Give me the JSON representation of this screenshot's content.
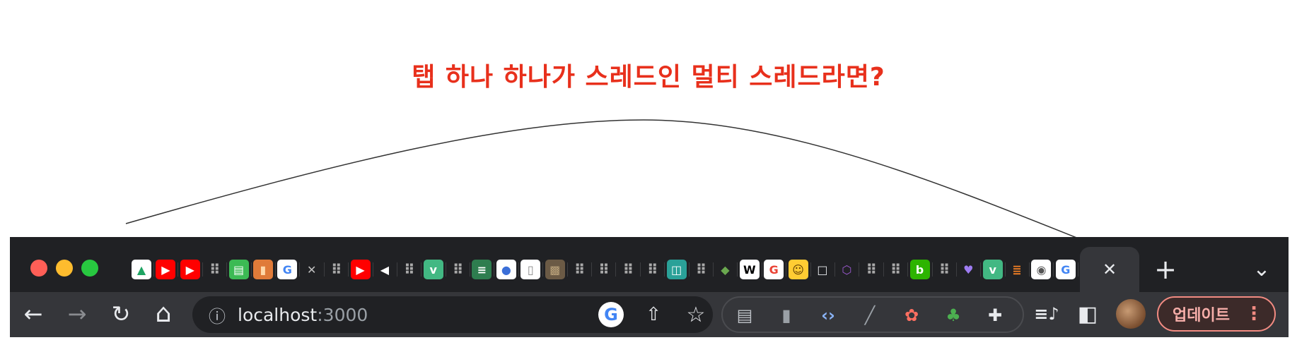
{
  "headline": {
    "text": "탭 하나 하나가 스레드인 멀티 스레드라면?",
    "color": "#e8301c"
  },
  "window_controls": [
    {
      "name": "close",
      "color": "#ff5f57"
    },
    {
      "name": "minimize",
      "color": "#febc2e"
    },
    {
      "name": "zoom",
      "color": "#28c840"
    }
  ],
  "tabs": {
    "favicons": [
      {
        "name": "google-drive-icon",
        "glyph": "▲",
        "bg": "#ffffff",
        "fg": "#1fa463"
      },
      {
        "name": "youtube-icon",
        "glyph": "▶",
        "bg": "#ff0000",
        "fg": "#ffffff"
      },
      {
        "name": "youtube-icon",
        "glyph": "▶",
        "bg": "#ff0000",
        "fg": "#ffffff"
      },
      {
        "name": "loading-dots-icon",
        "glyph": "⠿",
        "bg": "",
        "fg": ""
      },
      {
        "name": "chat-icon",
        "glyph": "▤",
        "bg": "#3cba54",
        "fg": "#ffffff"
      },
      {
        "name": "book-icon",
        "glyph": "▮",
        "bg": "#e07b39",
        "fg": "#ffd8a8"
      },
      {
        "name": "google-icon",
        "glyph": "G",
        "bg": "#ffffff",
        "fg": "#4285f4"
      },
      {
        "name": "tools-icon",
        "glyph": "✕",
        "bg": "",
        "fg": "#c0c0c0"
      },
      {
        "name": "loading-dots-icon",
        "glyph": "⠿",
        "bg": "",
        "fg": ""
      },
      {
        "name": "youtube-icon",
        "glyph": "▶",
        "bg": "#ff0000",
        "fg": "#ffffff"
      },
      {
        "name": "speaker-icon",
        "glyph": "◀",
        "bg": "",
        "fg": "#ffffff"
      },
      {
        "name": "loading-dots-icon",
        "glyph": "⠿",
        "bg": "",
        "fg": ""
      },
      {
        "name": "vuejs-icon",
        "glyph": "v",
        "bg": "#42b883",
        "fg": "#ffffff"
      },
      {
        "name": "loading-dots-icon",
        "glyph": "⠿",
        "bg": "",
        "fg": ""
      },
      {
        "name": "stack-icon",
        "glyph": "≡",
        "bg": "#2e7d4f",
        "fg": "#ffffff"
      },
      {
        "name": "badge-icon",
        "glyph": "●",
        "bg": "#ffffff",
        "fg": "#3b6fd8"
      },
      {
        "name": "paper-icon",
        "glyph": "▯",
        "bg": "#ffffff",
        "fg": "#888888"
      },
      {
        "name": "photo-icon",
        "glyph": "▩",
        "bg": "#6b5a45",
        "fg": "#bca47c"
      },
      {
        "name": "loading-dots-icon",
        "glyph": "⠿",
        "bg": "",
        "fg": ""
      },
      {
        "name": "loading-dots-icon",
        "glyph": "⠿",
        "bg": "",
        "fg": ""
      },
      {
        "name": "loading-dots-icon",
        "glyph": "⠿",
        "bg": "",
        "fg": ""
      },
      {
        "name": "loading-dots-icon",
        "glyph": "⠿",
        "bg": "",
        "fg": ""
      },
      {
        "name": "grid-app-icon",
        "glyph": "◫",
        "bg": "#2aa198",
        "fg": "#ffffff"
      },
      {
        "name": "loading-dots-icon",
        "glyph": "⠿",
        "bg": "",
        "fg": ""
      },
      {
        "name": "turtle-icon",
        "glyph": "◆",
        "bg": "",
        "fg": "#6aa84f"
      },
      {
        "name": "wikipedia-icon",
        "glyph": "W",
        "bg": "#ffffff",
        "fg": "#000000"
      },
      {
        "name": "google-icon",
        "glyph": "G",
        "bg": "#ffffff",
        "fg": "#ea4335"
      },
      {
        "name": "smiley-icon",
        "glyph": "☺",
        "bg": "#ffcc33",
        "fg": "#5a3a00"
      },
      {
        "name": "blank-page-icon",
        "glyph": "□",
        "bg": "",
        "fg": "#e8eaed"
      },
      {
        "name": "graphql-icon",
        "glyph": "⬡",
        "bg": "",
        "fg": "#9b59d0"
      },
      {
        "name": "loading-dots-icon",
        "glyph": "⠿",
        "bg": "",
        "fg": ""
      },
      {
        "name": "loading-dots-icon",
        "glyph": "⠿",
        "bg": "",
        "fg": ""
      },
      {
        "name": "blog-icon",
        "glyph": "b",
        "bg": "#2db400",
        "fg": "#ffffff"
      },
      {
        "name": "loading-dots-icon",
        "glyph": "⠿",
        "bg": "",
        "fg": ""
      },
      {
        "name": "heart-shield-icon",
        "glyph": "♥",
        "bg": "",
        "fg": "#9e7cf2"
      },
      {
        "name": "vuejs-icon",
        "glyph": "v",
        "bg": "#42b883",
        "fg": "#ffffff"
      },
      {
        "name": "stackoverflow-icon",
        "glyph": "≣",
        "bg": "",
        "fg": "#f48024"
      },
      {
        "name": "chrome-icon",
        "glyph": "◉",
        "bg": "#ffffff",
        "fg": "#555555"
      },
      {
        "name": "google-icon",
        "glyph": "G",
        "bg": "#ffffff",
        "fg": "#4285f4"
      }
    ],
    "active_tab_close": "✕",
    "new_tab": "+",
    "tab_search": "⌄"
  },
  "toolbar": {
    "back": "←",
    "forward": "→",
    "reload": "↻",
    "home": "⌂",
    "info_icon": "ⓘ",
    "url_host": "localhost",
    "url_port": ":3000",
    "google_lens": "G",
    "share": "⇧",
    "bookmark": "☆",
    "extensions": [
      {
        "name": "reader-mode-icon",
        "glyph": "▤",
        "fg": "#bdc1c6"
      },
      {
        "name": "mouse-icon",
        "glyph": "▮",
        "fg": "#9aa0a6"
      },
      {
        "name": "code-brackets-icon",
        "glyph": "‹›",
        "fg": "#8ab4f8"
      },
      {
        "name": "dropper-icon",
        "glyph": "╱",
        "fg": "#9aa0a6"
      },
      {
        "name": "bug-icon",
        "glyph": "✿",
        "fg": "#ff6f61"
      },
      {
        "name": "tree-icon",
        "glyph": "♣",
        "fg": "#4caf50"
      },
      {
        "name": "puzzle-icon",
        "glyph": "✚",
        "fg": "#e8eaed"
      }
    ],
    "media_control": "≡♪",
    "side_panel": "◧",
    "update_label": "업데이트",
    "menu_dots": "⋮"
  },
  "colors": {
    "tabstrip_bg": "#202124",
    "toolbar_bg": "#35363a",
    "update_accent": "#f28b82"
  }
}
